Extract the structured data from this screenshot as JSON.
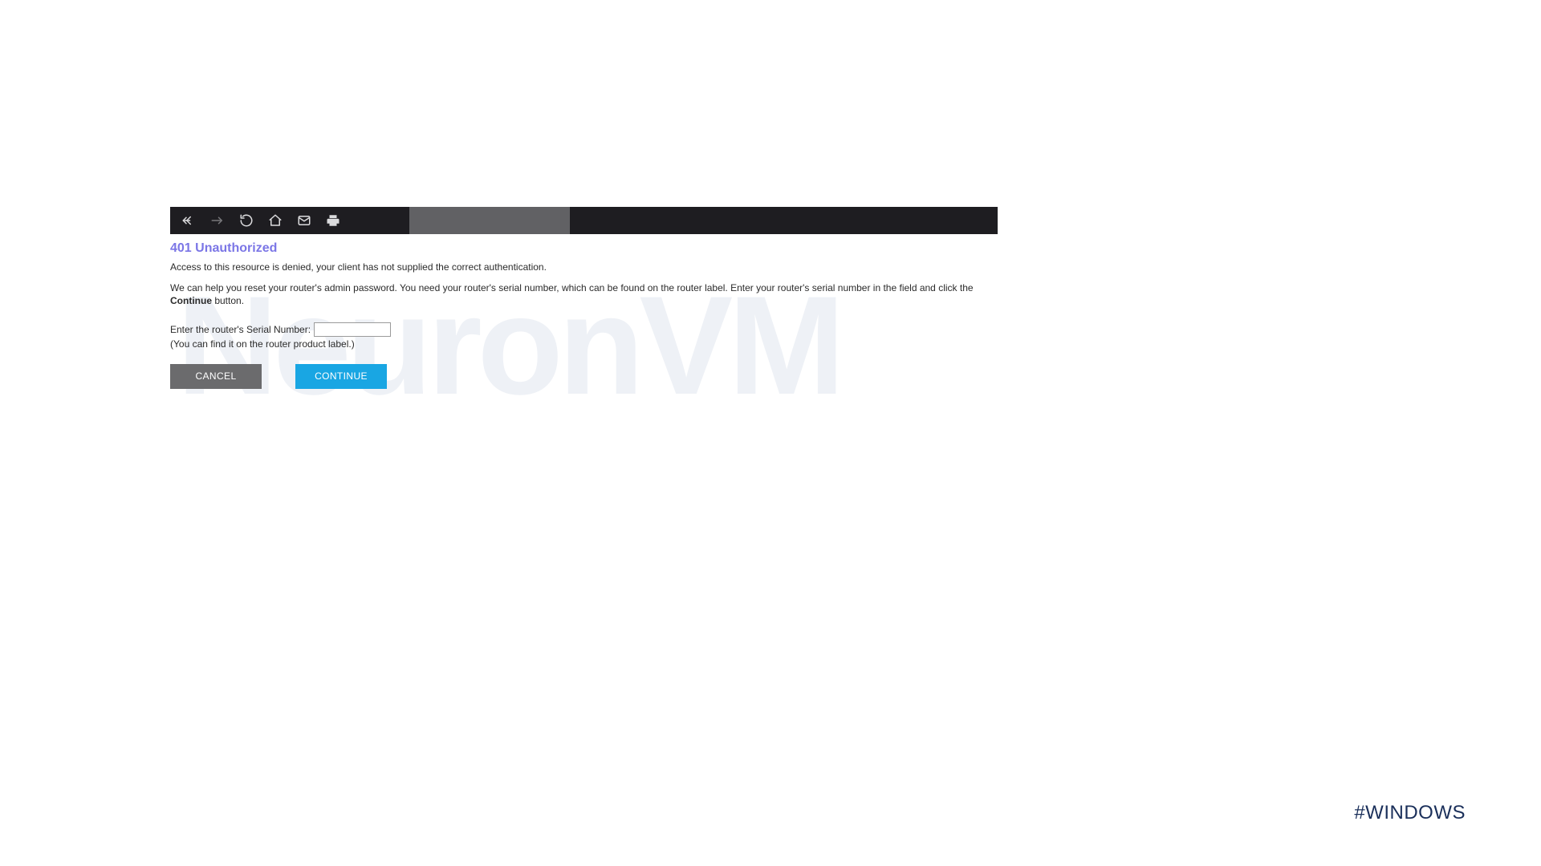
{
  "watermark_text": "NeuronVM",
  "page": {
    "title": "401 Unauthorized",
    "denied_text": "Access to this resource is denied, your client has not supplied the correct authentication.",
    "help_prefix": "We can help you reset your router's admin password. You need your router's serial number, which can be found on the router label. Enter your router's serial number in the field and click the ",
    "help_bold": "Continue",
    "help_suffix": " button.",
    "serial_label": "Enter the router's Serial Number:",
    "serial_value": "",
    "serial_hint": "(You can find it on the router product label.)",
    "buttons": {
      "cancel": "CANCEL",
      "continue": "CONTINUE"
    }
  },
  "footer_tag": "#WINDOWS"
}
